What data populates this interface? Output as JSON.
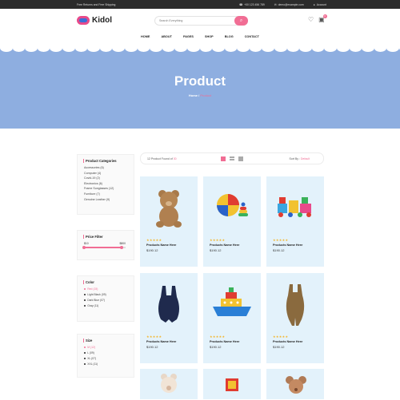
{
  "topbar": {
    "promo": "Free Returns and Free Shipping",
    "phone": "+00 123 456 789",
    "email": "demo@example.com",
    "account": "Account"
  },
  "header": {
    "logo": "Kidol",
    "search_placeholder": "Search Everything",
    "cart_count": "0"
  },
  "nav": [
    "HOME",
    "ABOUT",
    "PAGES",
    "SHOP",
    "BLOG",
    "CONTACT"
  ],
  "hero": {
    "title": "Product",
    "breadcrumb_home": "Home",
    "breadcrumb_current": "Product"
  },
  "sidebar": {
    "categories_title": "Product Categories",
    "categories": [
      "Accessories (6)",
      "Computer (4)",
      "Covid-19 (2)",
      "Electronics (6)",
      "Frame Sunglasses (12)",
      "Furniture (7)",
      "Genuine Leather (9)"
    ],
    "price_title": "Price Filter",
    "price_min": "$10",
    "price_max": "$800",
    "price_range": {
      "low": 0,
      "high": 0.9
    },
    "color_title": "Color",
    "colors": [
      "Red (15)",
      "Light Black (09)",
      "Dark Blue (07)",
      "Gray (11)"
    ],
    "size_title": "Size",
    "sizes": [
      "M (12)",
      "L (09)",
      "XL (07)",
      "XXL (11)"
    ]
  },
  "toolbar": {
    "found_prefix": "12 Product Found of",
    "found_total": "30",
    "sort_label": "Sort By :",
    "sort_value": "Default"
  },
  "products": [
    {
      "name": "Products Name Here",
      "price": "$190.12",
      "rating": 5,
      "icon": "teddy-bear"
    },
    {
      "name": "Products Name Here",
      "price": "$190.12",
      "rating": 5,
      "icon": "beach-ball"
    },
    {
      "name": "Products Name Here",
      "price": "$190.12",
      "rating": 5,
      "icon": "toy-train"
    },
    {
      "name": "Products Name Here",
      "price": "$190.12",
      "rating": 5,
      "icon": "navy-romper"
    },
    {
      "name": "Products Name Here",
      "price": "$190.12",
      "rating": 5,
      "icon": "toy-boat"
    },
    {
      "name": "Products Name Here",
      "price": "$190.12",
      "rating": 5,
      "icon": "brown-romper"
    }
  ],
  "colors": {
    "accent": "#f16d94",
    "hero": "#8eaee0",
    "card": "#e3f2fb",
    "topbar": "#2b2b2b",
    "star": "#f3b52a"
  }
}
